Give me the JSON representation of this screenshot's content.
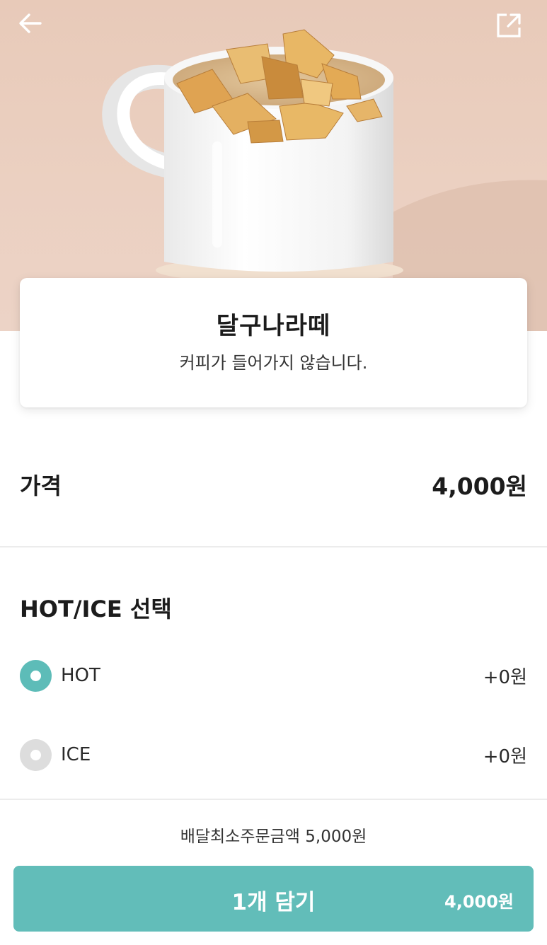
{
  "header": {
    "back_icon": "arrow-left-icon",
    "share_icon": "share-external-icon",
    "hero_image": "dalgona-latte-mug-photo"
  },
  "product": {
    "name": "달구나라떼",
    "description": "커피가 들어가지 않습니다."
  },
  "price": {
    "label": "가격",
    "value": "4,000원"
  },
  "options": {
    "title": "HOT/ICE 선택",
    "items": [
      {
        "label": "HOT",
        "price": "+0원",
        "selected": true
      },
      {
        "label": "ICE",
        "price": "+0원",
        "selected": false
      }
    ]
  },
  "footer": {
    "min_order": "배달최소주문금액 5,000원",
    "cart_label": "1개 담기",
    "cart_price": "4,000원"
  },
  "colors": {
    "accent": "#5dbcb8",
    "button": "#62bdb9",
    "radio_off": "#dddddd"
  }
}
